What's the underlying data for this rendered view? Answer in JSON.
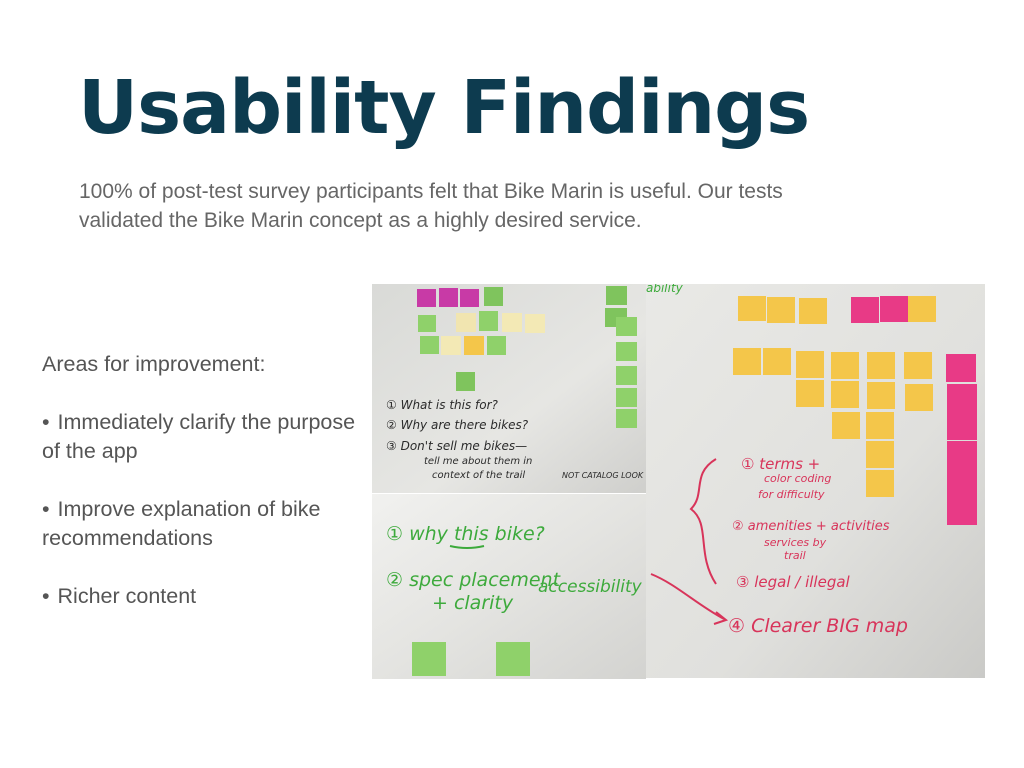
{
  "slide": {
    "title": "Usability Findings",
    "subtitle_lines": [
      "100% of post-test survey participants felt that Bike Marin is useful. Our tests",
      "validated the Bike Marin concept as a highly desired service."
    ]
  },
  "improvements": {
    "heading": "Areas for improvement:",
    "bullet_symbol": "•",
    "items": [
      "Immediately clarify the purpose of the app",
      "Improve explanation of bike recommendations",
      "Richer content"
    ]
  },
  "photos": {
    "board_a": {
      "notes": [
        "① What is this for?",
        "② Why are there bikes?",
        "③ Don't sell me bikes—",
        "tell me about them in",
        "context of the trail",
        "NOT CATALOG LOOK"
      ]
    },
    "board_b": {
      "notes": [
        "① why this bike?",
        "② spec placement",
        "+ clarity",
        "accessibility"
      ]
    },
    "board_c": {
      "header": "ability",
      "notes": [
        "① terms +",
        "color coding",
        "for difficulty",
        "② amenities + activities",
        "services by",
        "trail",
        "③ legal / illegal",
        "④ Clearer BIG map"
      ]
    }
  },
  "colors": {
    "title": "#0d3b4f",
    "body_text": "#666666",
    "sticky_green": "#8fd16a",
    "sticky_yellow": "#f4c64a",
    "sticky_pink": "#e83a86",
    "sticky_magenta": "#c83aa6",
    "sticky_cream": "#f3e9b5",
    "marker_black": "#2b2b2b",
    "marker_green": "#3daa3c",
    "marker_red": "#d8345a"
  }
}
